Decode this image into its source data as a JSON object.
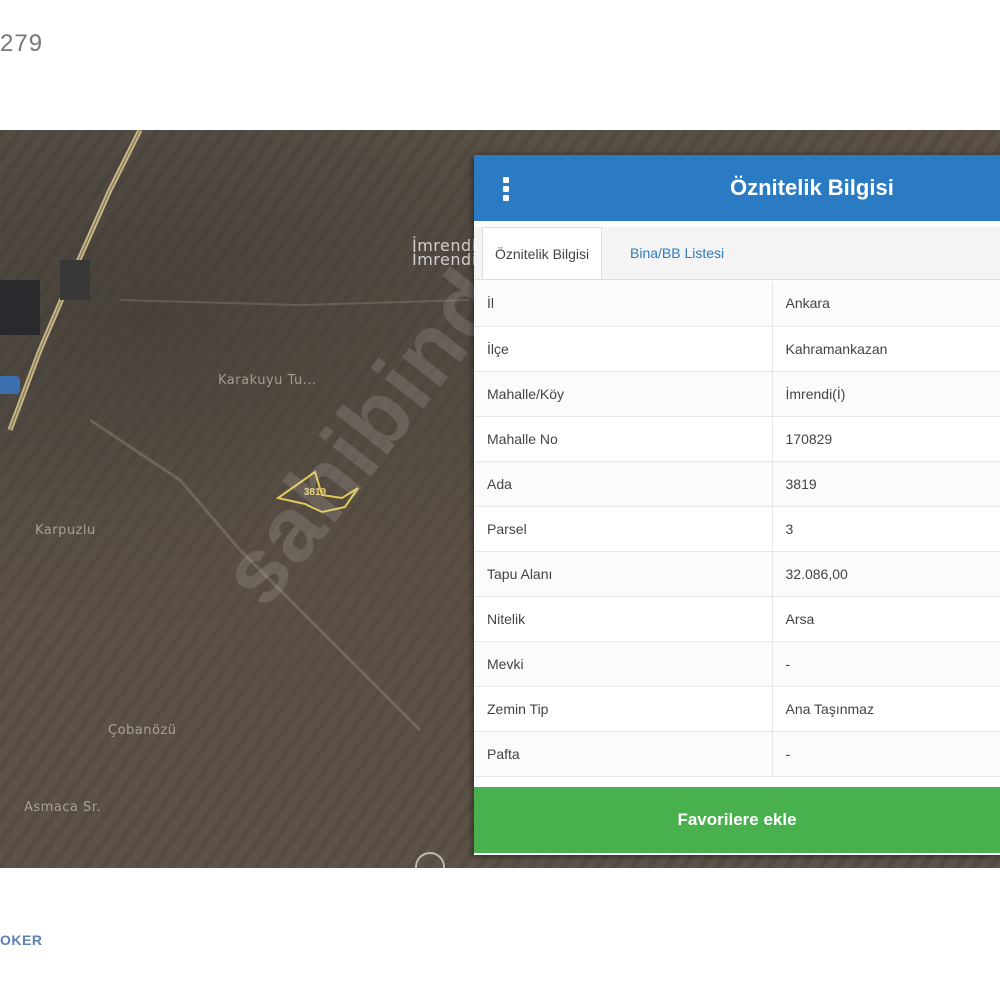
{
  "page": {
    "top_number": "279",
    "brand": "OKER"
  },
  "map": {
    "labels": {
      "imrendi_top": "İmrendi",
      "imrendi": "İmrendi",
      "karakuyu": "Karakuyu Tu...",
      "karpuzlu": "Karpuzlu",
      "cobanozu": "Çobanözü",
      "asmaca": "Asmaca Sr."
    },
    "parcel_label": "3819",
    "watermark": "sahibinden"
  },
  "panel": {
    "title": "Öznitelik Bilgisi",
    "tabs": [
      {
        "label": "Öznitelik Bilgisi",
        "active": true
      },
      {
        "label": "Bina/BB Listesi",
        "active": false
      }
    ],
    "rows": [
      {
        "key": "İl",
        "value": "Ankara"
      },
      {
        "key": "İlçe",
        "value": "Kahramankazan"
      },
      {
        "key": "Mahalle/Köy",
        "value": "İmrendi(İ)"
      },
      {
        "key": "Mahalle No",
        "value": "170829"
      },
      {
        "key": "Ada",
        "value": "3819"
      },
      {
        "key": "Parsel",
        "value": "3"
      },
      {
        "key": "Tapu Alanı",
        "value": "32.086,00"
      },
      {
        "key": "Nitelik",
        "value": "Arsa"
      },
      {
        "key": "Mevki",
        "value": "-"
      },
      {
        "key": "Zemin Tip",
        "value": "Ana Taşınmaz"
      },
      {
        "key": "Pafta",
        "value": "-"
      }
    ],
    "favorite_button": "Favorilere ekle"
  },
  "colors": {
    "header": "#2b7bc4",
    "button": "#48b04c",
    "tab_link": "#2b7bc4"
  },
  "icons": {
    "menu": "kebab-menu-icon",
    "compass": "compass-icon",
    "location": "location-pin-icon"
  }
}
